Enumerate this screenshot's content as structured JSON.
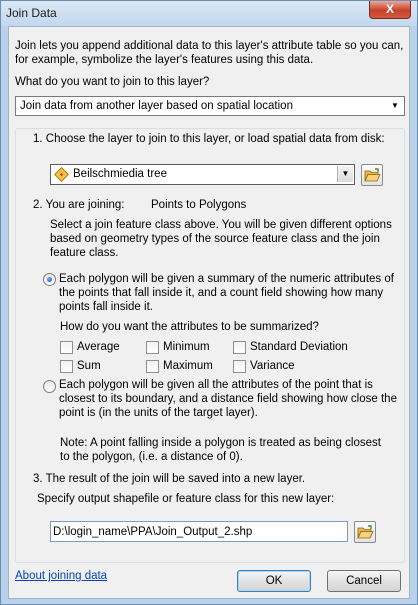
{
  "window": {
    "title": "Join Data",
    "close_label": "X"
  },
  "intro": "Join lets you append additional data to this layer's attribute table so you can, for example, symbolize the layer's features using this data.",
  "join_question": "What do you want to join to this layer?",
  "join_type": "Join data from another layer based on spatial location",
  "step1": {
    "label": "1.  Choose the layer to join to this layer, or load spatial data from disk:",
    "layer": "Beilschmiedia tree"
  },
  "step2": {
    "label": "2.  You are joining:",
    "joining_value": "Points to Polygons",
    "description": "Select a join feature class above.  You will be given different options based on geometry types of the source feature class and the join feature class.",
    "option1": "Each polygon will be given a summary of the numeric attributes of the points that fall inside it, and a count field showing how many points fall inside it.",
    "summarize_label": "How do you want the attributes to be summarized?",
    "checkboxes": [
      "Average",
      "Minimum",
      "Standard Deviation",
      "Sum",
      "Maximum",
      "Variance"
    ],
    "option2": "Each polygon will be given all the attributes of the point that is closest to its boundary, and a distance field showing how close the point is (in the units of the target layer).",
    "note": "Note: A point falling inside a polygon is treated as being closest to the polygon, (i.e. a distance of 0)."
  },
  "step3": {
    "label": "3.  The result of the join will be saved into a new layer.",
    "specify_label": "Specify output shapefile or feature class for this new layer:",
    "output_path": "D:\\login_name\\PPA\\Join_Output_2.shp"
  },
  "footer": {
    "about_link": "About joining data",
    "ok_label": "OK",
    "cancel_label": "Cancel"
  },
  "icons": {
    "layer": "point-layer-icon",
    "browse": "folder-open-icon"
  },
  "colors": {
    "link": "#0645ad",
    "title_bar": "#c3d7ee",
    "radio_dot": "#0b4fa8"
  }
}
